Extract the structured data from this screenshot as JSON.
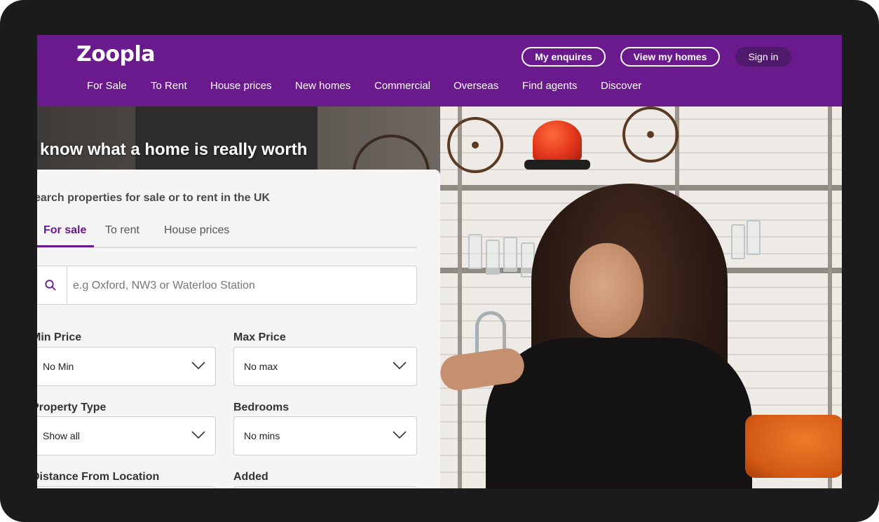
{
  "header": {
    "logo_text": "Zoopla",
    "my_enquires": "My enquires",
    "view_my_homes": "View my homes",
    "sign_in": "Sign in",
    "brand_color": "#6a1a8c"
  },
  "nav": {
    "items": [
      "For Sale",
      "To Rent",
      "House prices",
      "New homes",
      "Commercial",
      "Overseas",
      "Find agents",
      "Discover"
    ]
  },
  "hero": {
    "headline": "know what a home is really worth"
  },
  "search": {
    "title": "earch properties for sale or to rent in the UK",
    "tabs": [
      "For sale",
      "To rent",
      "House prices"
    ],
    "active_tab": "For sale",
    "placeholder": "e.g Oxford, NW3 or Waterloo Station",
    "icon": "search-icon"
  },
  "filters": {
    "min_price_label": "Min Price",
    "min_price_value": "No Min",
    "max_price_label": "Max Price",
    "max_price_value": "No max",
    "property_type_label": "Property Type",
    "property_type_value": "Show all",
    "bedrooms_label": "Bedrooms",
    "bedrooms_value": "No mins",
    "distance_label": "Distance From Location",
    "added_label": "Added"
  }
}
